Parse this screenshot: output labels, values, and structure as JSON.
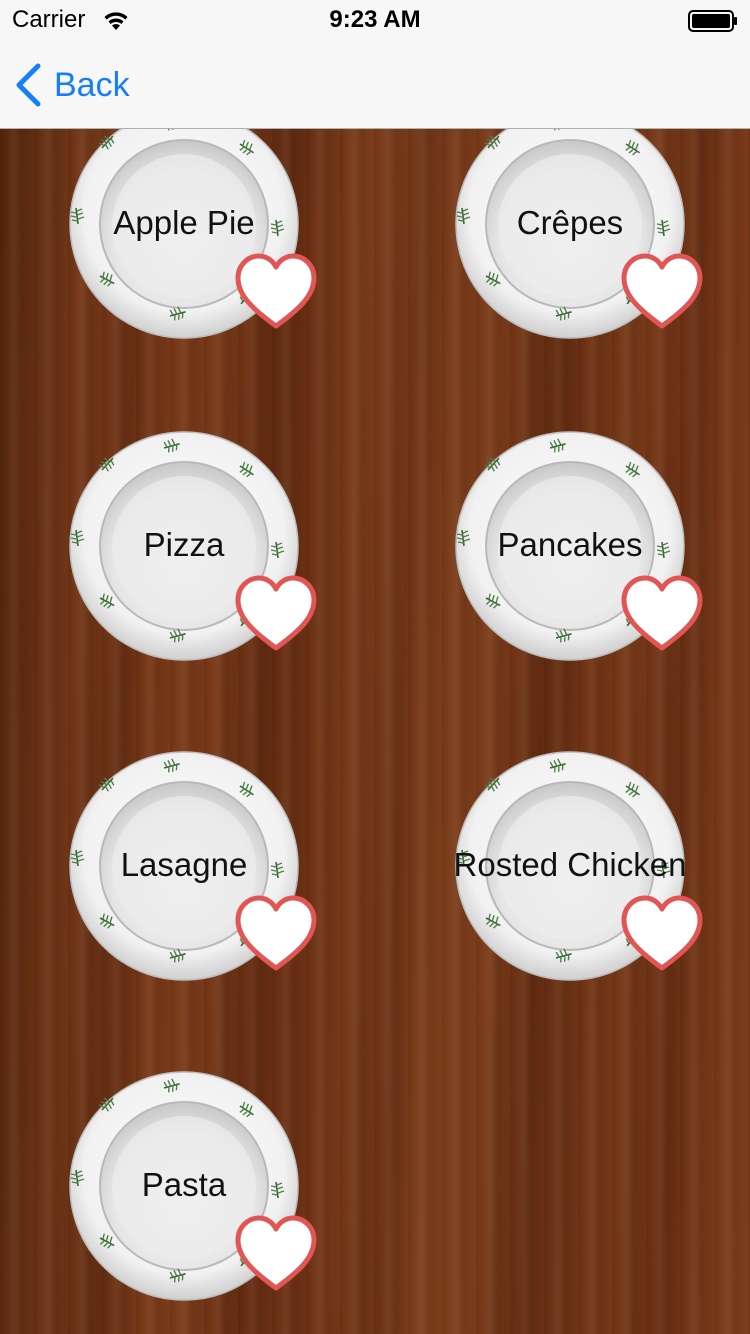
{
  "status_bar": {
    "carrier": "Carrier",
    "time": "9:23 AM"
  },
  "nav": {
    "back_label": "Back"
  },
  "colors": {
    "accent": "#147efb",
    "heart": "#e25555"
  },
  "dishes": [
    {
      "name": "Apple Pie"
    },
    {
      "name": "Crêpes"
    },
    {
      "name": "Pizza"
    },
    {
      "name": "Pancakes"
    },
    {
      "name": "Lasagne"
    },
    {
      "name": "Rosted Chicken"
    },
    {
      "name": "Pasta"
    }
  ],
  "icons": {
    "back": "chevron-left-icon",
    "favorite": "heart-icon",
    "wifi": "wifi-icon",
    "battery": "battery-icon"
  }
}
